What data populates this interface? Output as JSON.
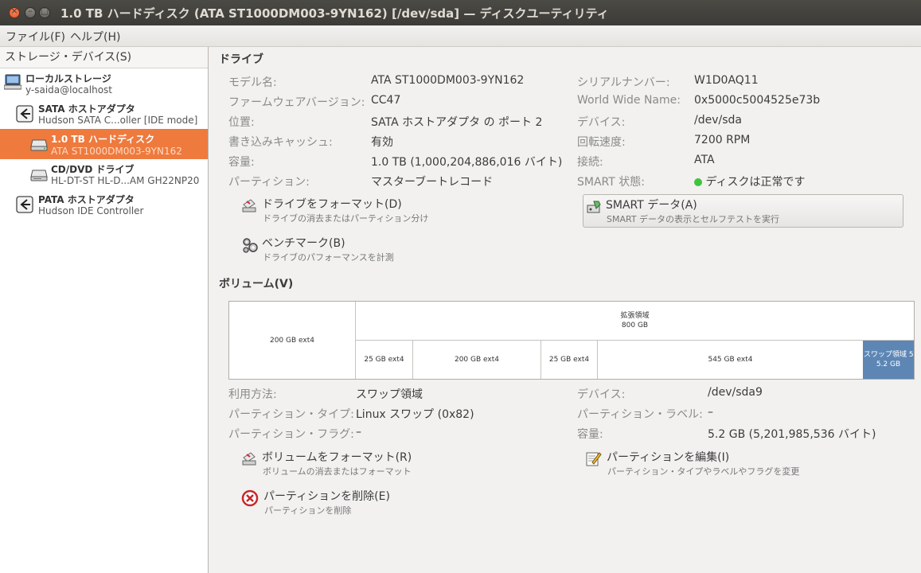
{
  "window": {
    "title": "1.0 TB ハードディスク (ATA ST1000DM003-9YN162) [/dev/sda] — ディスクユーティリティ"
  },
  "menu": {
    "file": "ファイル(F)",
    "help": "ヘルプ(H)"
  },
  "sidebar": {
    "header": "ストレージ・デバイス(S)",
    "items": [
      {
        "title": "ローカルストレージ",
        "subtitle": "y-saida@localhost",
        "icon": "computer-icon"
      },
      {
        "title": "SATA ホストアダプタ",
        "subtitle": "Hudson SATA C...oller [IDE mode]",
        "icon": "host-adapter-icon"
      },
      {
        "title": "1.0 TB ハードディスク",
        "subtitle": "ATA ST1000DM003-9YN162",
        "icon": "harddisk-icon",
        "selected": true
      },
      {
        "title": "CD/DVD ドライブ",
        "subtitle": "HL-DT-ST HL-D...AM GH22NP20",
        "icon": "optical-drive-icon"
      },
      {
        "title": "PATA ホストアダプタ",
        "subtitle": "Hudson IDE Controller",
        "icon": "host-adapter-icon"
      }
    ]
  },
  "drive": {
    "section_title": "ドライブ",
    "left": [
      {
        "label": "モデル名:",
        "value": "ATA ST1000DM003-9YN162"
      },
      {
        "label": "ファームウェアバージョン:",
        "value": "CC47"
      },
      {
        "label": "位置:",
        "value": "SATA ホストアダプタ の ポート 2"
      },
      {
        "label": "書き込みキャッシュ:",
        "value": "有効"
      },
      {
        "label": "容量:",
        "value": "1.0 TB (1,000,204,886,016 バイト)"
      },
      {
        "label": "パーティション:",
        "value": "マスターブートレコード"
      }
    ],
    "right": [
      {
        "label": "シリアルナンバー:",
        "value": "W1D0AQ11"
      },
      {
        "label": "World Wide Name:",
        "value": "0x5000c5004525e73b"
      },
      {
        "label": "デバイス:",
        "value": "/dev/sda"
      },
      {
        "label": "回転速度:",
        "value": "7200 RPM"
      },
      {
        "label": "接続:",
        "value": "ATA"
      },
      {
        "label": "SMART 状態:",
        "value": "ディスクは正常です"
      }
    ],
    "actions": {
      "format": {
        "title": "ドライブをフォーマット(D)",
        "subtitle": "ドライブの消去またはパーティション分け"
      },
      "benchmark": {
        "title": "ベンチマーク(B)",
        "subtitle": "ドライブのパフォーマンスを計測"
      },
      "smart": {
        "title": "SMART データ(A)",
        "subtitle": "SMART データの表示とセルフテストを実行"
      }
    },
    "smart_status_color": "#3ec43e"
  },
  "volumes": {
    "section_title": "ボリューム(V)",
    "map": {
      "primary": "200 GB ext4",
      "extended_label": "拡張領域",
      "extended_size": "800 GB",
      "logical": [
        {
          "label": "25 GB ext4"
        },
        {
          "label": "200 GB ext4"
        },
        {
          "label": "25 GB ext4"
        },
        {
          "label": "545 GB ext4"
        },
        {
          "label": "スワップ領域 5...",
          "size": "5.2 GB",
          "selected": true
        }
      ],
      "selected_color": "#5d86b5"
    },
    "left": [
      {
        "label": "利用方法:",
        "value": "スワップ領域"
      },
      {
        "label": "パーティション・タイプ:",
        "value": "Linux スワップ (0x82)"
      },
      {
        "label": "パーティション・フラグ:",
        "value": "–"
      }
    ],
    "right": [
      {
        "label": "デバイス:",
        "value": "/dev/sda9"
      },
      {
        "label": "パーティション・ラベル:",
        "value": "–"
      },
      {
        "label": "容量:",
        "value": "5.2 GB (5,201,985,536 バイト)"
      }
    ],
    "actions": {
      "format": {
        "title": "ボリュームをフォーマット(R)",
        "subtitle": "ボリュームの消去またはフォーマット"
      },
      "delete": {
        "title": "パーティションを削除(E)",
        "subtitle": "パーティションを削除"
      },
      "edit": {
        "title": "パーティションを編集(I)",
        "subtitle": "パーティション・タイプやラベルやフラグを変更"
      }
    }
  }
}
